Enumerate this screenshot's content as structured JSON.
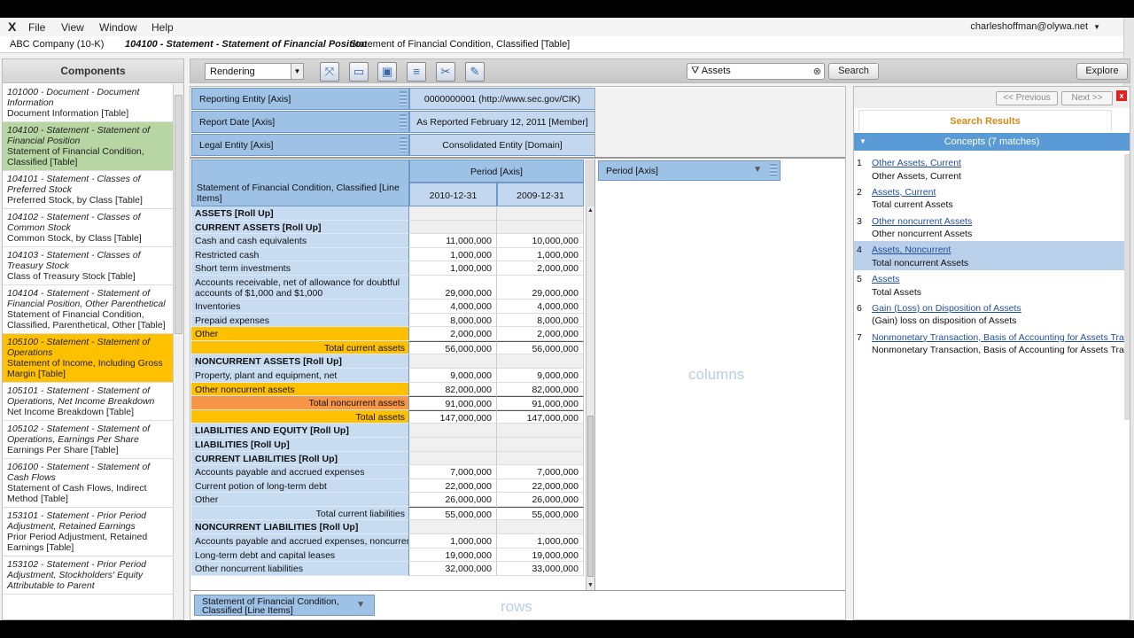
{
  "menubar": {
    "logo": "X",
    "menus": [
      "File",
      "View",
      "Window",
      "Help"
    ],
    "user": "charleshoffman@olywa.net"
  },
  "titlebar": {
    "company": "ABC Company (10-K)",
    "network": "104100 - Statement - Statement of Financial Position",
    "table": "Statement of Financial Condition, Classified [Table]"
  },
  "components": {
    "header": "Components",
    "items": [
      {
        "t1": "101000 - Document - Document Information",
        "t2": "Document Information [Table]",
        "style": ""
      },
      {
        "t1": "104100 - Statement - Statement of Financial Position",
        "t2": "Statement of Financial Condition, Classified [Table]",
        "style": "green"
      },
      {
        "t1": "104101 - Statement - Classes of Preferred Stock",
        "t2": "Preferred Stock, by Class [Table]",
        "style": ""
      },
      {
        "t1": "104102 - Statement - Classes of Common Stock",
        "t2": "Common Stock, by Class [Table]",
        "style": ""
      },
      {
        "t1": "104103 - Statement - Classes of Treasury Stock",
        "t2": "Class of Treasury Stock [Table]",
        "style": ""
      },
      {
        "t1": "104104 - Statement - Statement of Financial Position, Other Parenthetical",
        "t2": "Statement of Financial Condition, Classified, Parenthetical, Other [Table]",
        "style": ""
      },
      {
        "t1": "105100 - Statement - Statement of Operations",
        "t2": "Statement of Income, Including Gross Margin [Table]",
        "style": "yellow"
      },
      {
        "t1": "105101 - Statement - Statement of Operations, Net Income Breakdown",
        "t2": "Net Income Breakdown [Table]",
        "style": ""
      },
      {
        "t1": "105102 - Statement - Statement of Operations, Earnings Per Share",
        "t2": "Earnings Per Share [Table]",
        "style": ""
      },
      {
        "t1": "106100 - Statement - Statement of Cash Flows",
        "t2": "Statement of Cash Flows, Indirect Method [Table]",
        "style": ""
      },
      {
        "t1": "153101 - Statement - Prior Period Adjustment, Retained Earnings",
        "t2": "Prior Period Adjustment, Retained Earnings [Table]",
        "style": ""
      },
      {
        "t1": "153102 - Statement - Prior Period Adjustment, Stockholders' Equity Attributable to Parent",
        "t2": "",
        "style": ""
      }
    ]
  },
  "toolbar": {
    "view_select": "Rendering",
    "view_select_arrow": "▼",
    "search_value": "Assets",
    "search_filter_icon": "⛛",
    "search_clear_icon": "⊗",
    "search_button": "Search",
    "explore_button": "Explore"
  },
  "rendering": {
    "axes": [
      {
        "label": "Reporting Entity [Axis]",
        "value": "0000000001 (http://www.sec.gov/CIK)"
      },
      {
        "label": "Report Date [Axis]",
        "value": "As Reported February 12, 2011 [Member]"
      },
      {
        "label": "Legal Entity [Axis]",
        "value": "Consolidated Entity [Domain]"
      }
    ],
    "line_items_header": "Statement of Financial Condition, Classified [Line Items]",
    "period_header": "Period [Axis]",
    "dates": [
      "2010-12-31",
      "2009-12-31"
    ],
    "period_axis_chip": "Period [Axis]",
    "columns_label": "columns",
    "rows_label": "rows",
    "rows_axis_chip": "Statement of Financial Condition, Classified [Line Items]",
    "rows": [
      {
        "label": "ASSETS [Roll Up]",
        "v1": "",
        "v2": "",
        "kind": "rollup"
      },
      {
        "label": "CURRENT ASSETS [Roll Up]",
        "v1": "",
        "v2": "",
        "kind": "rollup"
      },
      {
        "label": "Cash and cash equivalents",
        "v1": "11,000,000",
        "v2": "10,000,000",
        "kind": ""
      },
      {
        "label": "Restricted cash",
        "v1": "1,000,000",
        "v2": "1,000,000",
        "kind": ""
      },
      {
        "label": "Short term investments",
        "v1": "1,000,000",
        "v2": "2,000,000",
        "kind": ""
      },
      {
        "label": "Accounts receivable, net of allowance for doubtful accounts of $1,000 and $1,000",
        "v1": "29,000,000",
        "v2": "29,000,000",
        "kind": "tall"
      },
      {
        "label": "Inventories",
        "v1": "4,000,000",
        "v2": "4,000,000",
        "kind": ""
      },
      {
        "label": "Prepaid expenses",
        "v1": "8,000,000",
        "v2": "8,000,000",
        "kind": ""
      },
      {
        "label": "Other",
        "v1": "2,000,000",
        "v2": "2,000,000",
        "kind": "yellow"
      },
      {
        "label": "Total current assets",
        "v1": "56,000,000",
        "v2": "56,000,000",
        "kind": "total yellow"
      },
      {
        "label": "NONCURRENT ASSETS [Roll Up]",
        "v1": "",
        "v2": "",
        "kind": "rollup"
      },
      {
        "label": "Property, plant and equipment, net",
        "v1": "9,000,000",
        "v2": "9,000,000",
        "kind": ""
      },
      {
        "label": "Other noncurrent assets",
        "v1": "82,000,000",
        "v2": "82,000,000",
        "kind": "yellow"
      },
      {
        "label": "Total noncurrent assets",
        "v1": "91,000,000",
        "v2": "91,000,000",
        "kind": "total orange"
      },
      {
        "label": "Total assets",
        "v1": "147,000,000",
        "v2": "147,000,000",
        "kind": "total yellow"
      },
      {
        "label": "LIABILITIES AND EQUITY [Roll Up]",
        "v1": "",
        "v2": "",
        "kind": "rollup"
      },
      {
        "label": "LIABILITIES [Roll Up]",
        "v1": "",
        "v2": "",
        "kind": "rollup"
      },
      {
        "label": "CURRENT LIABILITIES [Roll Up]",
        "v1": "",
        "v2": "",
        "kind": "rollup"
      },
      {
        "label": "Accounts payable and accrued expenses",
        "v1": "7,000,000",
        "v2": "7,000,000",
        "kind": ""
      },
      {
        "label": "Current potion of long-term debt",
        "v1": "22,000,000",
        "v2": "22,000,000",
        "kind": ""
      },
      {
        "label": "Other",
        "v1": "26,000,000",
        "v2": "26,000,000",
        "kind": ""
      },
      {
        "label": "Total current liabilities",
        "v1": "55,000,000",
        "v2": "55,000,000",
        "kind": "total"
      },
      {
        "label": "NONCURRENT LIABILITIES [Roll Up]",
        "v1": "",
        "v2": "",
        "kind": "rollup"
      },
      {
        "label": "Accounts payable and accrued expenses, noncurrent",
        "v1": "1,000,000",
        "v2": "1,000,000",
        "kind": ""
      },
      {
        "label": "Long-term debt and capital leases",
        "v1": "19,000,000",
        "v2": "19,000,000",
        "kind": ""
      },
      {
        "label": "Other noncurrent liabilities",
        "v1": "32,000,000",
        "v2": "33,000,000",
        "kind": ""
      }
    ]
  },
  "search_panel": {
    "prev": "<< Previous",
    "next": "Next >>",
    "close": "x",
    "tab": "Search Results",
    "concepts_bar": "Concepts (7 matches)",
    "results": [
      {
        "num": "1",
        "link": "Other Assets, Current",
        "desc": "Other Assets, Current",
        "sel": false
      },
      {
        "num": "2",
        "link": "Assets, Current",
        "desc": "Total current Assets",
        "sel": false
      },
      {
        "num": "3",
        "link": "Other noncurrent Assets",
        "desc": "Other noncurrent Assets",
        "sel": false
      },
      {
        "num": "4",
        "link": "Assets, Noncurrent",
        "desc": "Total noncurrent Assets",
        "sel": true
      },
      {
        "num": "5",
        "link": "Assets",
        "desc": "Total Assets",
        "sel": false
      },
      {
        "num": "6",
        "link": "Gain (Loss) on Disposition of Assets",
        "desc": "(Gain) loss on disposition of Assets",
        "sel": false
      },
      {
        "num": "7",
        "link": "Nonmonetary Transaction, Basis of Accounting for Assets Transf",
        "desc": "Nonmonetary Transaction, Basis of Accounting for Assets Transf",
        "sel": false
      }
    ]
  }
}
